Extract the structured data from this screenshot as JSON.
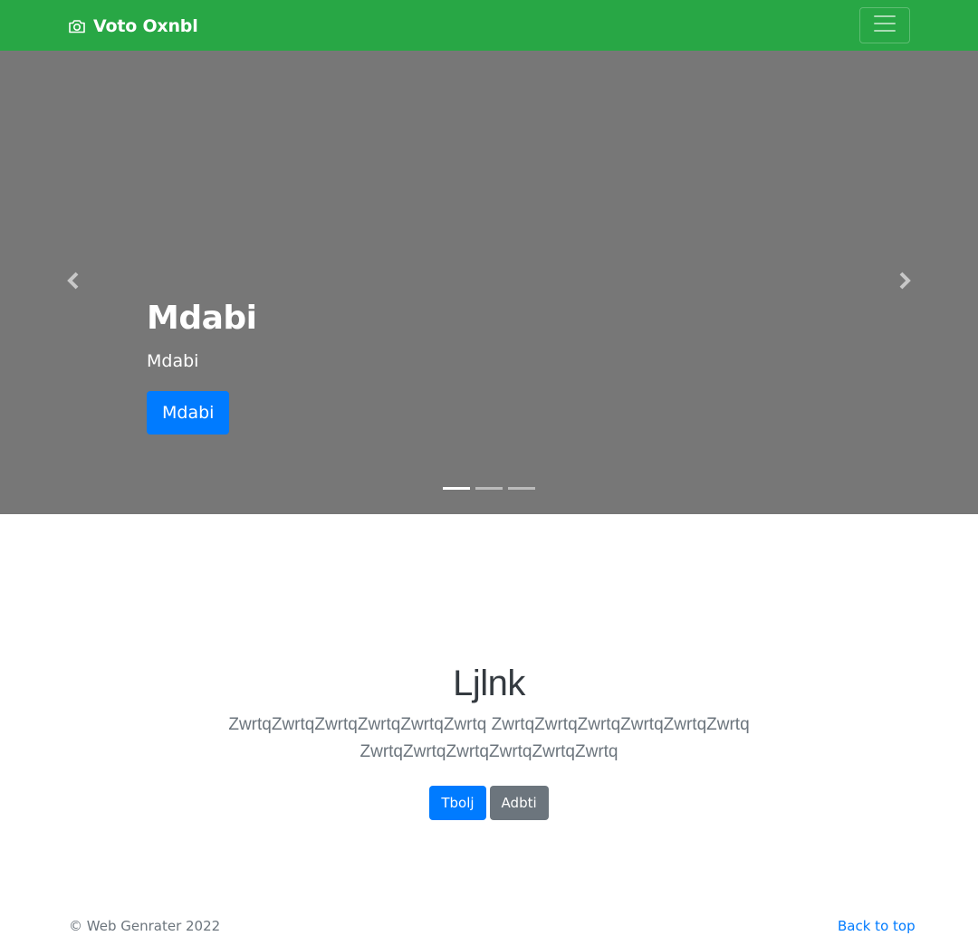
{
  "navbar": {
    "brand_icon": "camera-icon",
    "brand_text": "Voto Oxnbl",
    "toggler_icon": "hamburger-menu-icon",
    "background": "#28a745"
  },
  "carousel": {
    "background": "#777777",
    "prev_icon": "chevron-left-icon",
    "next_icon": "chevron-right-icon",
    "caption": {
      "title": "Mdabi",
      "text": "Mdabi",
      "button_label": "Mdabi"
    },
    "indicators": [
      {
        "active": true
      },
      {
        "active": false
      },
      {
        "active": false
      }
    ]
  },
  "jumbotron": {
    "title": "Ljlnk",
    "lead": "ZwrtqZwrtqZwrtqZwrtqZwrtqZwrtq ZwrtqZwrtqZwrtqZwrtqZwrtqZwrtq ZwrtqZwrtqZwrtqZwrtqZwrtqZwrtq",
    "primary_button": "Tbolj",
    "secondary_button": "Adbti"
  },
  "footer": {
    "copyright": "© Web Genrater 2022",
    "back_to_top": "Back to top"
  },
  "colors": {
    "primary": "#007bff",
    "secondary": "#6c757d",
    "success": "#28a745"
  }
}
